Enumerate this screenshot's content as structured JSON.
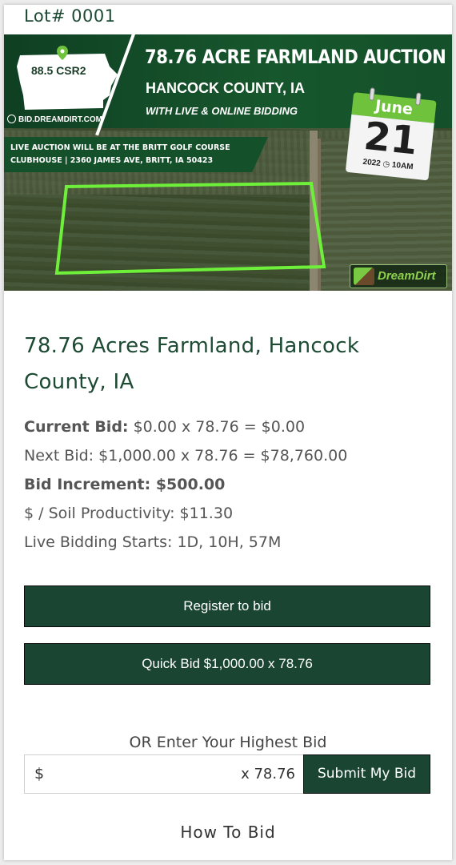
{
  "lot": {
    "label": "Lot# 0001"
  },
  "banner": {
    "map_label": "88.5 CSR2",
    "website": "BID.DREAMDIRT.COM",
    "headline": "78.76 ACRE FARMLAND AUCTION",
    "county": "HANCOCK COUNTY, IA",
    "bidding_note": "WITH LIVE & ONLINE BIDDING",
    "location_line1": "LIVE AUCTION WILL BE AT THE BRITT GOLF COURSE",
    "location_line2": "CLUBHOUSE | 2360 JAMES AVE, BRITT, IA 50423",
    "calendar_month": "June",
    "calendar_day": "21",
    "calendar_year": "2022",
    "calendar_time": "10AM",
    "logo_text": "DreamDirt",
    "colors": {
      "header_green": "#14502a",
      "boundary": "#6ef03a",
      "calendar_green": "#6fc23c"
    }
  },
  "listing": {
    "title": "78.76 Acres Farmland, Hancock County, IA",
    "current_bid_label": "Current Bid:",
    "current_bid_value": "$0.00 x 78.76 = $0.00",
    "next_bid": "Next Bid: $1,000.00 x 78.76 = $78,760.00",
    "bid_increment": "Bid Increment: $500.00",
    "soil_productivity": "$ / Soil Productivity: $11.30",
    "live_bidding": "Live Bidding Starts: 1D, 10H, 57M"
  },
  "actions": {
    "register_label": "Register to bid",
    "quick_bid_label": "Quick Bid $1,000.00 x 78.76",
    "or_label": "OR Enter Your Highest Bid",
    "currency_symbol": "$",
    "bid_input_value": "",
    "multiplier": "x 78.76",
    "submit_label": "Submit My Bid",
    "how_to_label": "How To Bid"
  },
  "theme": {
    "primary": "#1a4532",
    "heading": "#1c4a33",
    "text": "#555555"
  }
}
